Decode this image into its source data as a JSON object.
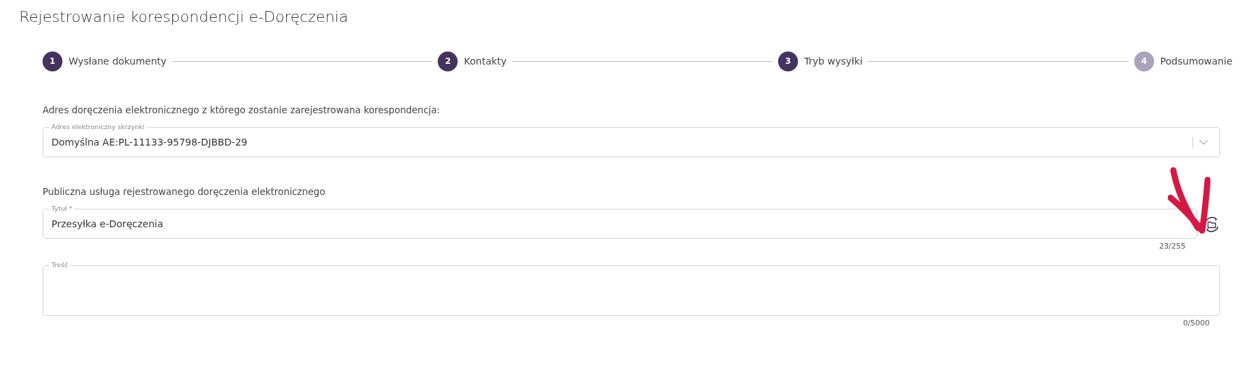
{
  "title": "Rejestrowanie korespondencji e-Doręczenia",
  "steps": [
    {
      "number": "1",
      "label": "Wysłane dokumenty",
      "reached": true
    },
    {
      "number": "2",
      "label": "Kontakty",
      "reached": true
    },
    {
      "number": "3",
      "label": "Tryb wysyłki",
      "reached": true
    },
    {
      "number": "4",
      "label": "Podsumowanie",
      "reached": false
    }
  ],
  "sender_section": {
    "heading": "Adres doręczenia elektronicznego z którego zostanie zarejestrowana korespondencja:",
    "field": {
      "label": "Adres elektroniczny skrzynki",
      "value": "Domyślna AE:PL-11133-95798-DJBBD-29"
    }
  },
  "service_section": {
    "heading": "Publiczna usługa rejestrowanego doręczenia elektronicznego",
    "title_field": {
      "label": "Tytuł *",
      "value": "Przesyłka e-Doręczenia",
      "counter": "23/255"
    },
    "content_field": {
      "label": "Treść",
      "counter": "0/5000"
    }
  }
}
